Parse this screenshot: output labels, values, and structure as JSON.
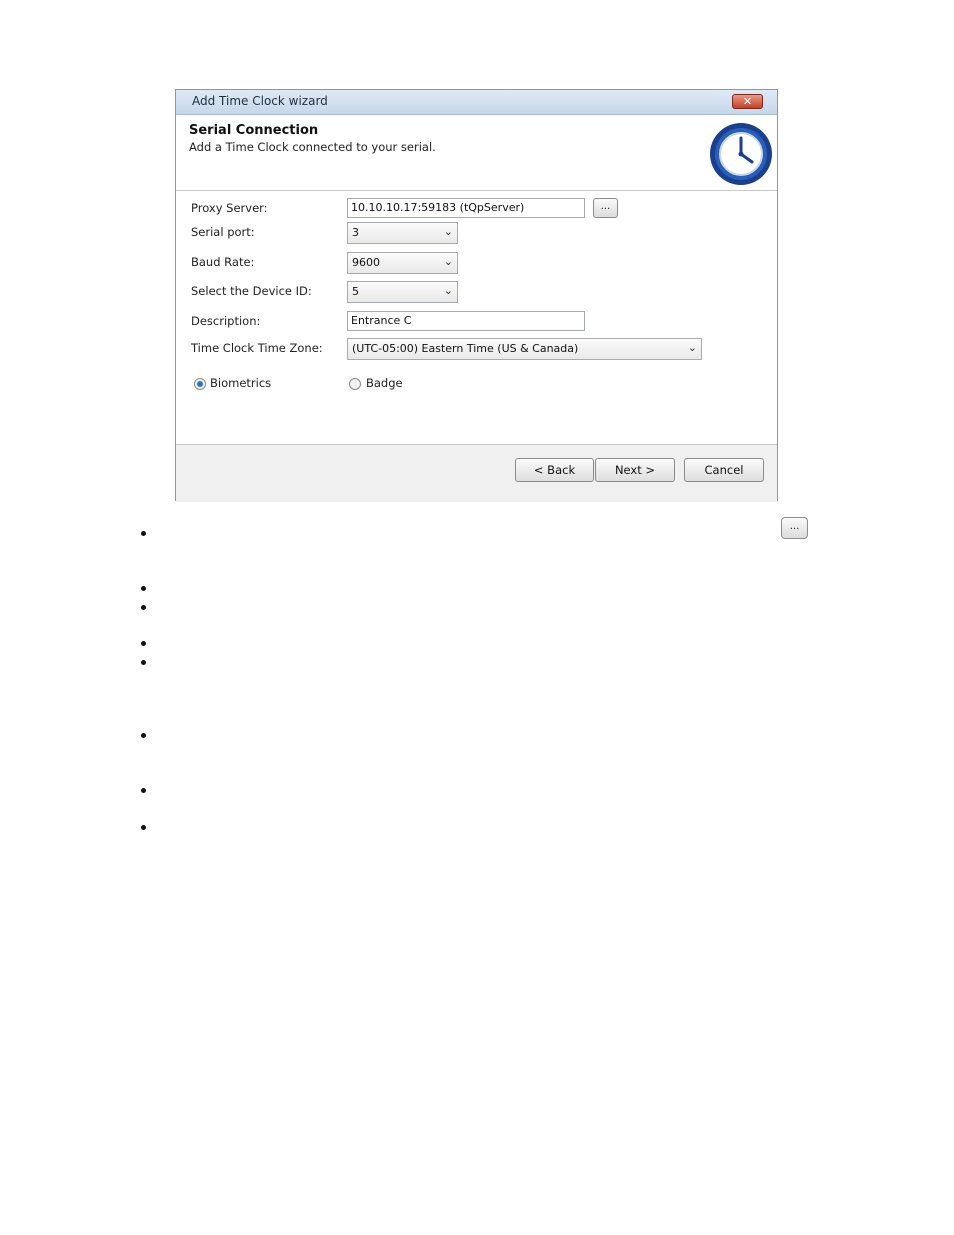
{
  "window": {
    "title": "Add Time Clock wizard",
    "close_glyph": "✕"
  },
  "header": {
    "title": "Serial Connection",
    "subtitle": "Add a Time Clock connected to your serial.",
    "icon": "clock-icon"
  },
  "form": {
    "proxy_label": "Proxy Server:",
    "proxy_value": "10.10.10.17:59183 (tQpServer)",
    "browse_label": "...",
    "serial_label": "Serial port:",
    "serial_value": "3",
    "baud_label": "Baud Rate:",
    "baud_value": "9600",
    "device_label": "Select the Device ID:",
    "device_value": "5",
    "description_label": "Description:",
    "description_value": "Entrance C",
    "timezone_label": "Time Clock Time Zone:",
    "timezone_value": "(UTC-05:00) Eastern Time (US & Canada)",
    "radio_biometrics": "Biometrics",
    "radio_badge": "Badge",
    "selected_mode": "Biometrics"
  },
  "buttons": {
    "back": "< Back",
    "next": "Next >",
    "cancel": "Cancel"
  },
  "page": {
    "browse_icon_label": "..."
  },
  "colors": {
    "accent": "#2f74c0",
    "titlebar": "#c7d7ea",
    "close": "#c3402a",
    "clock": "#1a3f8f"
  }
}
